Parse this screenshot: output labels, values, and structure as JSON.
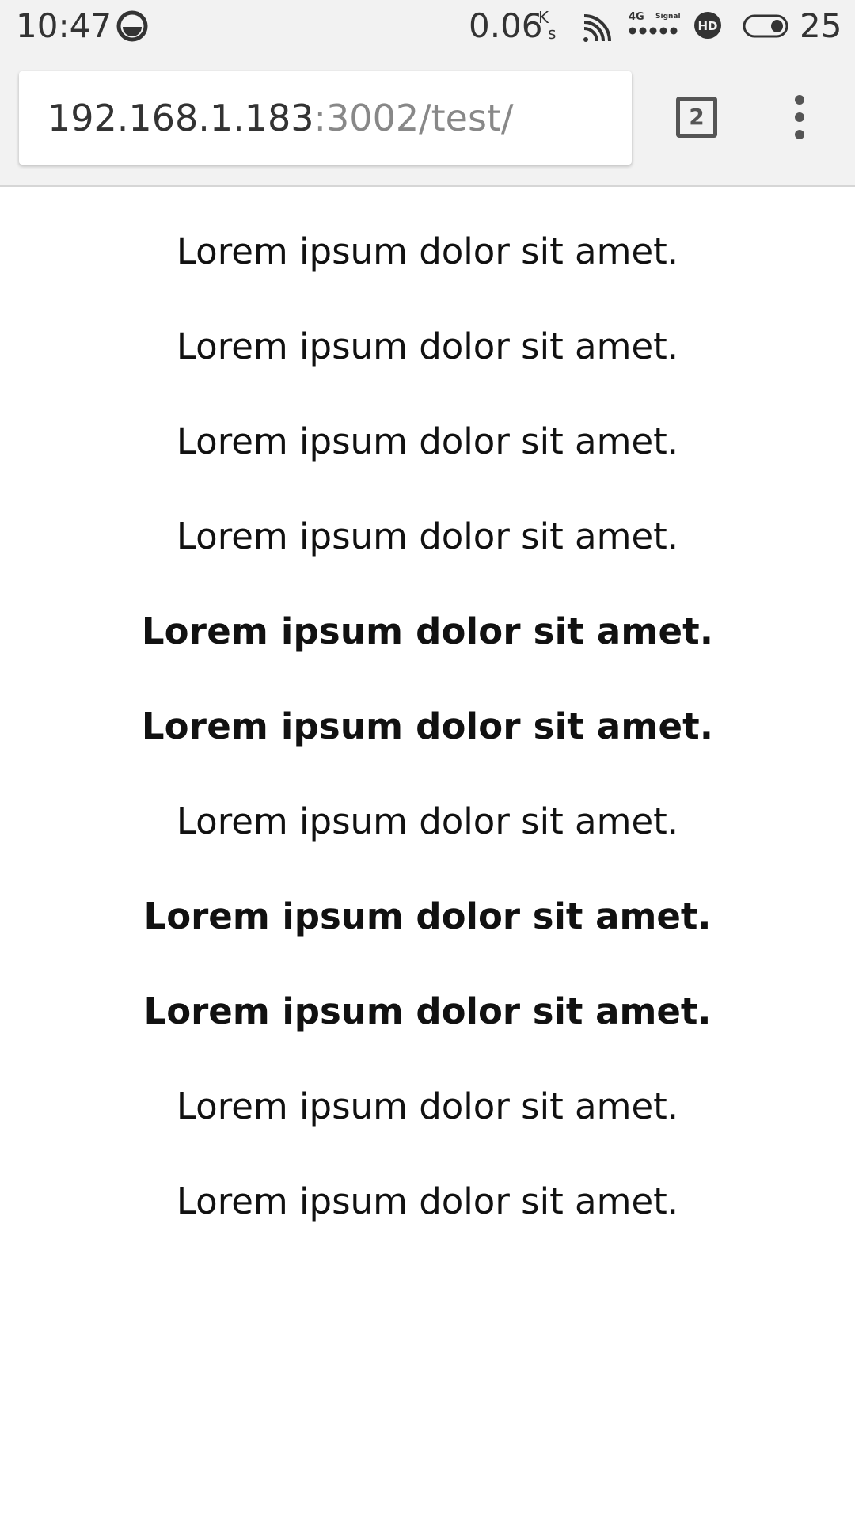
{
  "status_bar": {
    "time": "10:47",
    "app_icon": "browser-notification-icon",
    "speed": "0.06",
    "speed_unit_top": "K",
    "speed_unit_bottom": "s",
    "wifi_icon": "wifi-icon",
    "network": "4G",
    "signal_label": "Signal",
    "hd_icon": "hd-icon",
    "battery_icon": "battery-icon",
    "battery_level": "25"
  },
  "toolbar": {
    "url_host": "192.168.1.183",
    "url_rest": ":3002/test/",
    "tab_count": "2",
    "menu_icon": "more-vert-icon"
  },
  "content": {
    "lines": [
      {
        "text": "Lorem ipsum dolor sit amet.",
        "weight": "light"
      },
      {
        "text": "Lorem ipsum dolor sit amet.",
        "weight": "light"
      },
      {
        "text": "Lorem ipsum dolor sit amet.",
        "weight": "light"
      },
      {
        "text": "Lorem ipsum dolor sit amet.",
        "weight": "light"
      },
      {
        "text": "Lorem ipsum dolor sit amet.",
        "weight": "medium"
      },
      {
        "text": "Lorem ipsum dolor sit amet.",
        "weight": "medium"
      },
      {
        "text": "Lorem ipsum dolor sit amet.",
        "weight": "regular"
      },
      {
        "text": "Lorem ipsum dolor sit amet.",
        "weight": "bold"
      },
      {
        "text": "Lorem ipsum dolor sit amet.",
        "weight": "bold"
      },
      {
        "text": "Lorem ipsum dolor sit amet.",
        "weight": "light"
      },
      {
        "text": "Lorem ipsum dolor sit amet.",
        "weight": "regular"
      }
    ]
  }
}
